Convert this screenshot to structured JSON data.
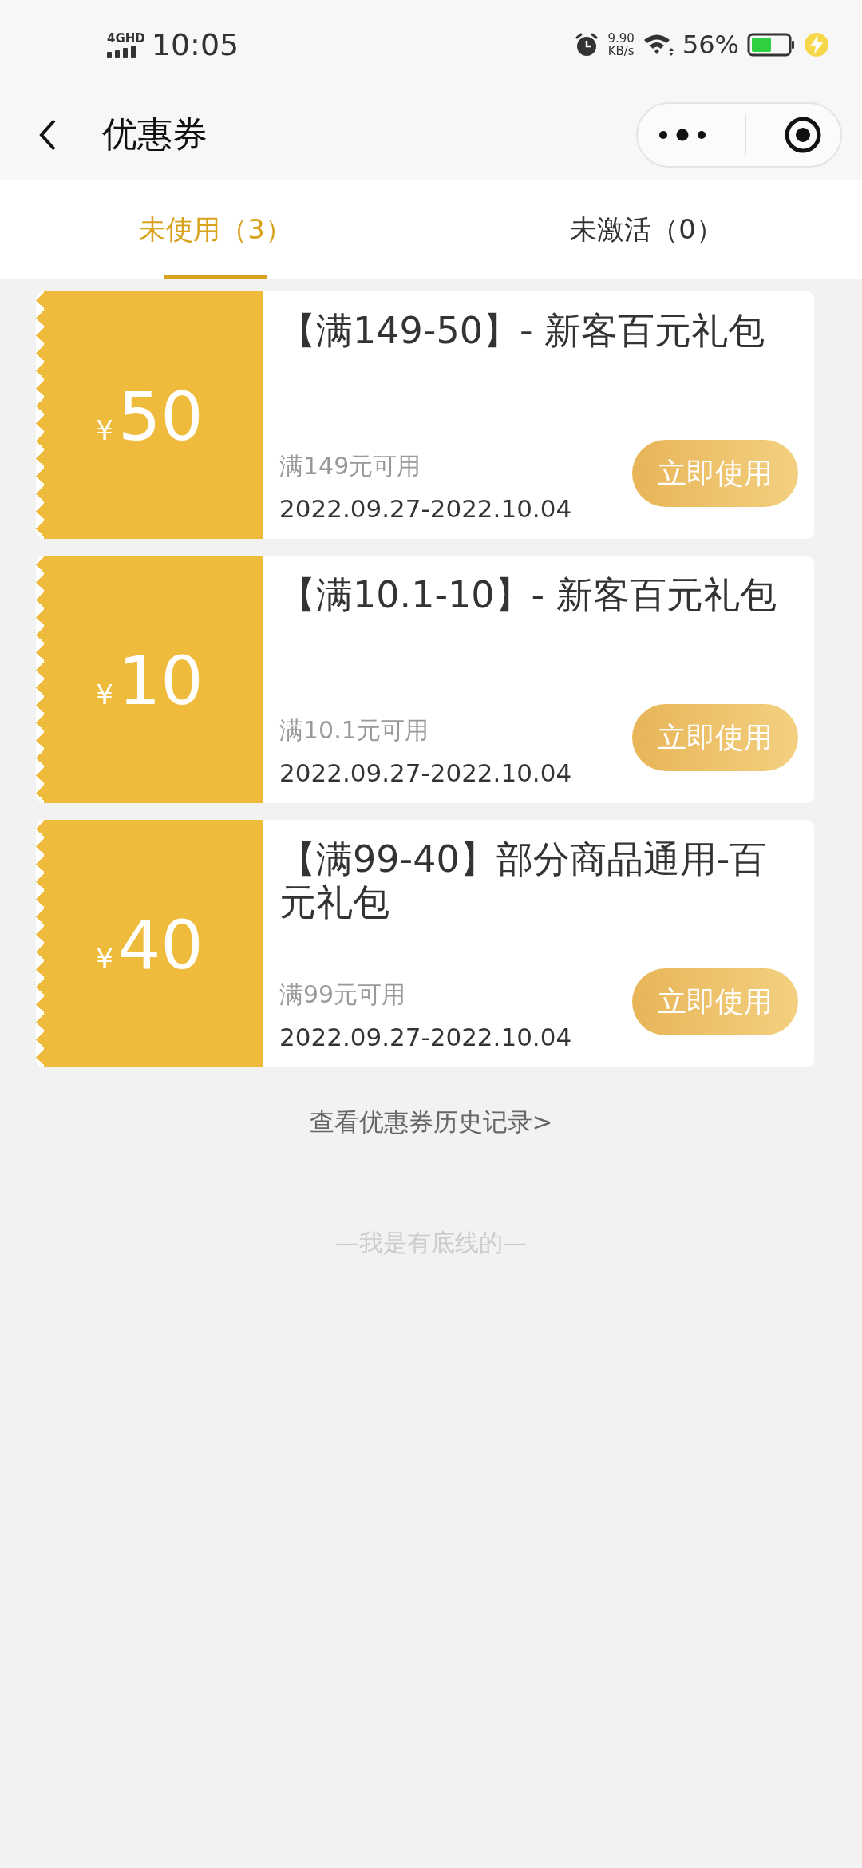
{
  "status_bar": {
    "network": "4GHD",
    "time": "10:05",
    "speed_value": "9.90",
    "speed_unit": "KB/s",
    "battery": "56%"
  },
  "nav": {
    "title": "优惠券"
  },
  "tabs": [
    {
      "label": "未使用（3）",
      "selected": true
    },
    {
      "label": "未激活（0）",
      "selected": false
    }
  ],
  "coupons": [
    {
      "currency": "¥",
      "amount": "50",
      "title": "【满149-50】- 新客百元礼包",
      "condition": "满149元可用",
      "validity": "2022.09.27-2022.10.04",
      "button": "立即使用"
    },
    {
      "currency": "¥",
      "amount": "10",
      "title": "【满10.1-10】- 新客百元礼包",
      "condition": "满10.1元可用",
      "validity": "2022.09.27-2022.10.04",
      "button": "立即使用"
    },
    {
      "currency": "¥",
      "amount": "40",
      "title": "【满99-40】部分商品通用-百元礼包",
      "condition": "满99元可用",
      "validity": "2022.09.27-2022.10.04",
      "button": "立即使用"
    }
  ],
  "history_link": "查看优惠券历史记录>",
  "footer": "—我是有底线的—"
}
